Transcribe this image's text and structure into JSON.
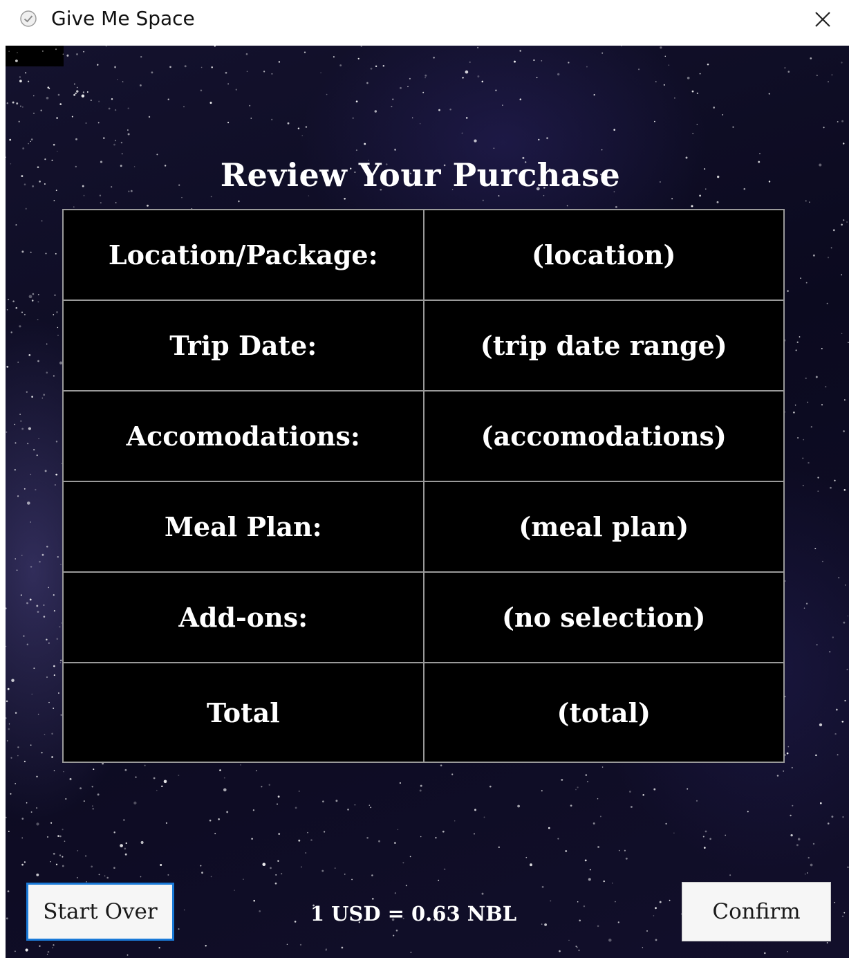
{
  "window": {
    "title": "Give Me Space",
    "close_icon": "close-icon"
  },
  "page": {
    "heading": "Review Your Purchase"
  },
  "summary": {
    "rows": [
      {
        "label": "Location/Package:",
        "value": "(location)"
      },
      {
        "label": "Trip Date:",
        "value": "(trip date range)"
      },
      {
        "label": "Accomodations:",
        "value": "(accomodations)"
      },
      {
        "label": "Meal Plan:",
        "value": "(meal plan)"
      },
      {
        "label": "Add-ons:",
        "value": "(no selection)"
      },
      {
        "label": "Total",
        "value": "(total)"
      }
    ]
  },
  "footer": {
    "start_over_label": "Start Over",
    "exchange_rate": "1 USD = 0.63 NBL",
    "confirm_label": "Confirm"
  },
  "colors": {
    "background": "#0b0a1f",
    "table_background": "#000000",
    "table_border": "#9a9a9a",
    "text": "#ffffff",
    "focus_border": "#1a7ad8"
  }
}
